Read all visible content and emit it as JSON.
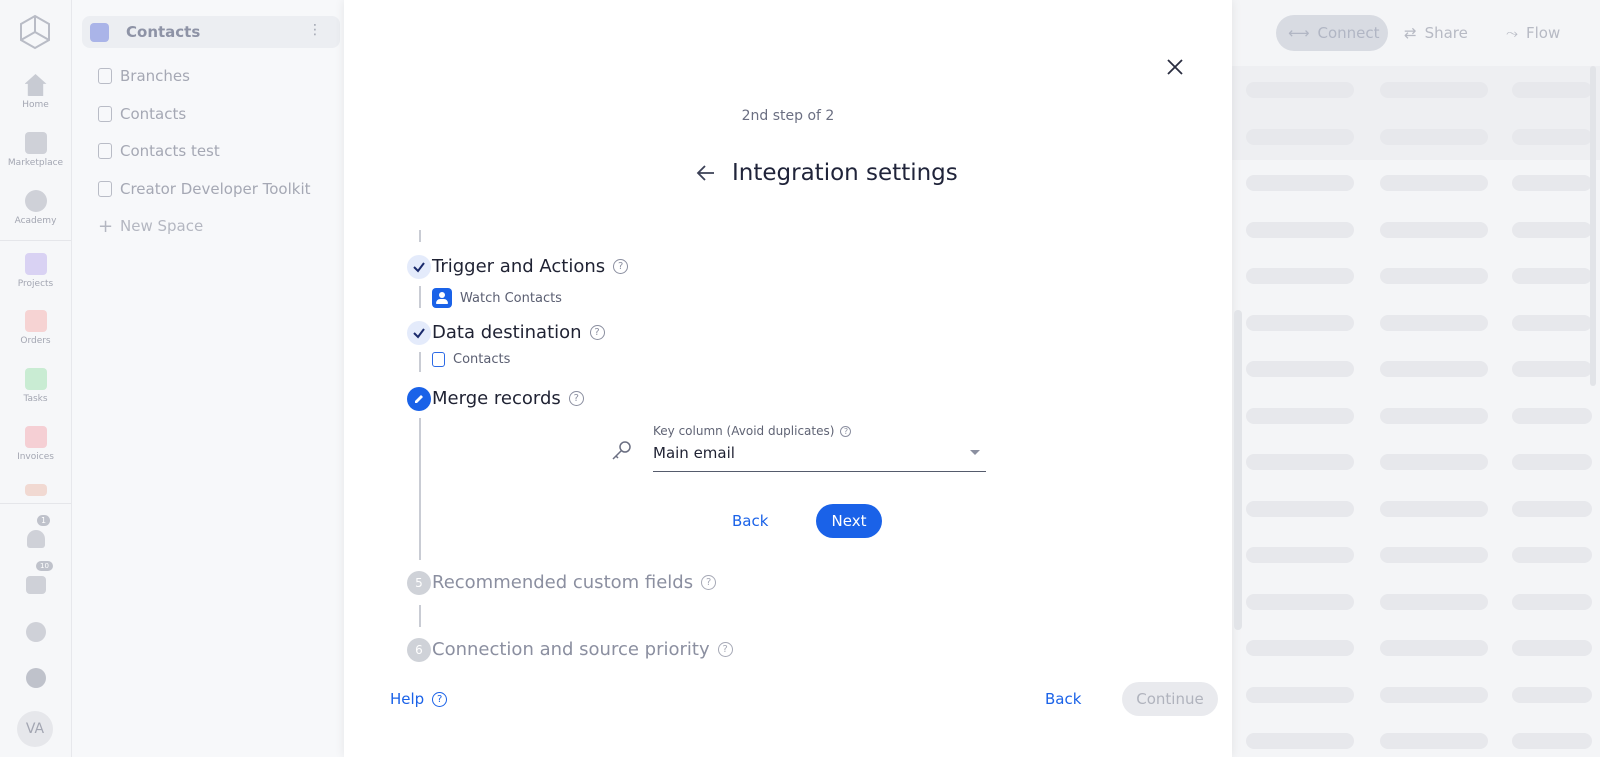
{
  "rail": {
    "items": [
      {
        "label": "Home"
      },
      {
        "label": "Marketplace"
      },
      {
        "label": "Academy"
      },
      {
        "label": "Projects"
      },
      {
        "label": "Orders"
      },
      {
        "label": "Tasks"
      },
      {
        "label": "Invoices"
      }
    ],
    "notifications_badge": "1",
    "updates_badge": "10",
    "avatar_initials": "VA"
  },
  "spaces": {
    "header": "Contacts",
    "items": [
      {
        "label": "Branches"
      },
      {
        "label": "Contacts"
      },
      {
        "label": "Contacts test"
      },
      {
        "label": "Creator Developer Toolkit"
      }
    ],
    "new_space": "New Space"
  },
  "topbar": {
    "connect": "Connect",
    "share": "Share",
    "flow": "Flow"
  },
  "modal": {
    "step_of": "2nd step of 2",
    "title": "Integration settings",
    "steps": [
      {
        "number": "",
        "title": "Trigger and Actions",
        "sub": "Watch Contacts",
        "state": "done"
      },
      {
        "number": "",
        "title": "Data destination",
        "sub": "Contacts",
        "state": "done"
      },
      {
        "number": "",
        "title": "Merge records",
        "state": "active"
      },
      {
        "number": "5",
        "title": "Recommended custom fields",
        "state": "pending"
      },
      {
        "number": "6",
        "title": "Connection and source priority",
        "state": "pending"
      }
    ],
    "key_column_label": "Key column (Avoid duplicates)",
    "key_column_value": "Main email",
    "inner_back": "Back",
    "inner_next": "Next",
    "help": "Help",
    "footer_back": "Back",
    "footer_continue": "Continue"
  }
}
